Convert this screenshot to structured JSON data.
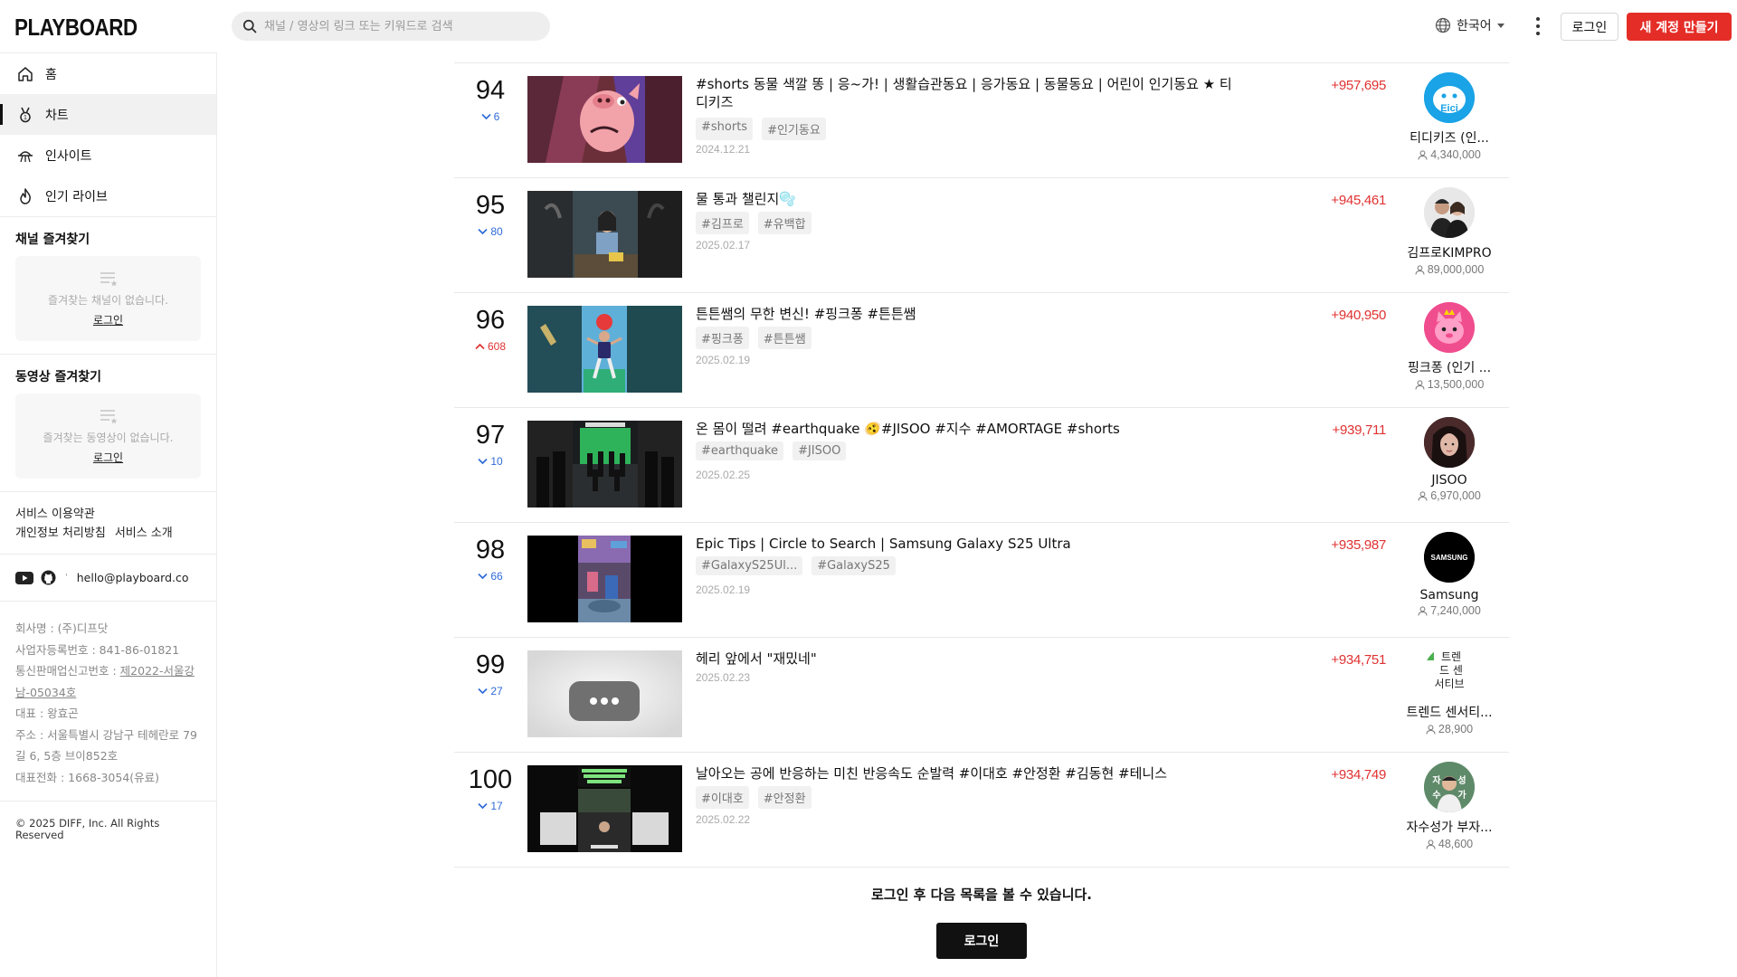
{
  "header": {
    "logo": "PLAYBOARD",
    "search_placeholder": "채널 / 영상의 링크 또는 키워드로 검색",
    "language": "한국어",
    "login_label": "로그인",
    "signup_label": "새 계정 만들기",
    "accent_color": "#e52d27"
  },
  "sidebar": {
    "nav": [
      {
        "label": "홈",
        "icon": "home-icon"
      },
      {
        "label": "차트",
        "icon": "medal-icon",
        "active": true
      },
      {
        "label": "인사이트",
        "icon": "insight-icon"
      },
      {
        "label": "인기 라이브",
        "icon": "fire-icon"
      }
    ],
    "channel_favorites": {
      "title": "채널 즐겨찾기",
      "empty_text": "즐겨찾는 채널이 없습니다.",
      "login": "로그인"
    },
    "video_favorites": {
      "title": "동영상 즐겨찾기",
      "empty_text": "즐겨찾는 동영상이 없습니다.",
      "login": "로그인"
    },
    "links": {
      "terms": "서비스 이용약관",
      "privacy": "개인정보 처리방침",
      "about": "서비스 소개"
    },
    "email": "hello@playboard.co",
    "company": {
      "name": "회사명 : (주)디프닷",
      "biz_no": "사업자등록번호 : 841-86-01821",
      "ecommerce_prefix": "통신판매업신고번호 : ",
      "ecommerce_no": "제2022-서울강남-05034호",
      "ceo": "대표 : 왕효곤",
      "address": "주소 : 서울특별시 강남구 테헤란로 79길 6, 5층 브이852호",
      "phone": "대표전화 : 1668-3054(유료)"
    },
    "copyright": "© 2025 DIFF, Inc. All Rights Reserved"
  },
  "rows": [
    {
      "rank": "94",
      "direction": "down",
      "change": "6",
      "title": "#shorts 동물 색깔 똥 | 응~가! | 생활습관동요 | 응가동요 | 동물동요 | 어린이 인기동요 ★ 티디키즈",
      "tags": [
        "#shorts",
        "#인기동요"
      ],
      "date": "2024.12.21",
      "views": "+957,695",
      "channel": "티디키즈 (인...",
      "subscribers": "4,340,000",
      "avatar_text": "Eici"
    },
    {
      "rank": "95",
      "direction": "down",
      "change": "80",
      "title": "물 통과 챌린지🫧",
      "tags": [
        "#김프로",
        "#유백합"
      ],
      "date": "2025.02.17",
      "views": "+945,461",
      "channel": "김프로KIMPRO",
      "subscribers": "89,000,000",
      "avatar_text": ""
    },
    {
      "rank": "96",
      "direction": "up",
      "change": "608",
      "title": "튼튼쌤의 무한 변신! #핑크퐁 #튼튼쌤",
      "tags": [
        "#핑크퐁",
        "#튼튼쌤"
      ],
      "date": "2025.02.19",
      "views": "+940,950",
      "channel": "핑크퐁 (인기 ...",
      "subscribers": "13,500,000",
      "avatar_text": ""
    },
    {
      "rank": "97",
      "direction": "down",
      "change": "10",
      "title": "온 몸이 떨려 #earthquake 🫨#JISOO #지수 #AMORTAGE #shorts",
      "tags": [
        "#earthquake",
        "#JISOO"
      ],
      "date": "2025.02.25",
      "views": "+939,711",
      "channel": "JISOO",
      "subscribers": "6,970,000",
      "avatar_text": ""
    },
    {
      "rank": "98",
      "direction": "down",
      "change": "66",
      "title": "Epic Tips | Circle to Search | Samsung Galaxy S25 Ultra",
      "tags": [
        "#GalaxyS25Ul...",
        "#GalaxyS25"
      ],
      "date": "2025.02.19",
      "views": "+935,987",
      "channel": "Samsung",
      "subscribers": "7,240,000",
      "avatar_text": "SAMSUNG"
    },
    {
      "rank": "99",
      "direction": "down",
      "change": "27",
      "title": "헤리 앞에서 \"재밌네\"",
      "tags": [],
      "date": "2025.02.23",
      "views": "+934,751",
      "channel": "트렌드 센서티...",
      "subscribers": "28,900",
      "avatar_text": "트렌드 센서티브"
    },
    {
      "rank": "100",
      "direction": "down",
      "change": "17",
      "title": "날아오는 공에 반응하는 미친 반응속도 순발력 #이대호 #안정환 #김동현 #테니스",
      "tags": [
        "#이대호",
        "#안정환"
      ],
      "date": "2025.02.22",
      "views": "+934,749",
      "channel": "자수성가 부자...",
      "subscribers": "48,600",
      "avatar_text": "자수성가"
    }
  ],
  "footer": {
    "more_text": "로그인 후 다음 목록을 볼 수 있습니다.",
    "login": "로그인"
  }
}
